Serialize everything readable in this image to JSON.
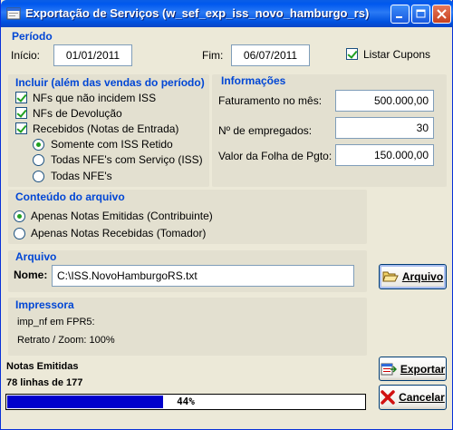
{
  "window": {
    "title": "Exportação de Serviços (w_sef_exp_iss_novo_hamburgo_rs)"
  },
  "periodo": {
    "title": "Período",
    "inicio_label": "Início:",
    "inicio_value": "01/01/2011",
    "fim_label": "Fim:",
    "fim_value": "06/07/2011",
    "listar_cupons_label": "Listar Cupons",
    "listar_cupons_checked": true
  },
  "incluir": {
    "title": "Incluir (além das vendas do período)",
    "items": [
      {
        "label": "NFs que não incidem ISS",
        "checked": true
      },
      {
        "label": "NFs de Devolução",
        "checked": true
      },
      {
        "label": "Recebidos (Notas de Entrada)",
        "checked": true
      }
    ],
    "radios": [
      {
        "label": "Somente com ISS Retido",
        "selected": true
      },
      {
        "label": "Todas NFE's com Serviço (ISS)",
        "selected": false
      },
      {
        "label": "Todas NFE's",
        "selected": false
      }
    ]
  },
  "informacoes": {
    "title": "Informações",
    "faturamento_label": "Faturamento no mês:",
    "faturamento_value": "500.000,00",
    "empregados_label": "Nº de empregados:",
    "empregados_value": "30",
    "folha_label": "Valor da Folha de Pgto:",
    "folha_value": "150.000,00"
  },
  "conteudo": {
    "title": "Conteúdo do arquivo",
    "options": [
      {
        "label": "Apenas Notas Emitidas (Contribuinte)",
        "selected": true
      },
      {
        "label": "Apenas Notas Recebidas (Tomador)",
        "selected": false
      }
    ]
  },
  "arquivo": {
    "title": "Arquivo",
    "nome_label": "Nome:",
    "nome_value": "C:\\ISS.NovoHamburgoRS.txt",
    "button_label": "Arquivo"
  },
  "impressora": {
    "title": "Impressora",
    "line1": "imp_nf em FPR5:",
    "line2": "Retrato / Zoom: 100%"
  },
  "status": {
    "title": "Notas Emitidas",
    "lines": "78 linhas de 177",
    "progress_percent": 44,
    "progress_text": "44%"
  },
  "buttons": {
    "exportar": "Exportar",
    "cancelar": "Cancelar"
  },
  "colors": {
    "accent": "#0046d5",
    "progress": "#0000cc",
    "check": "#21a121"
  }
}
